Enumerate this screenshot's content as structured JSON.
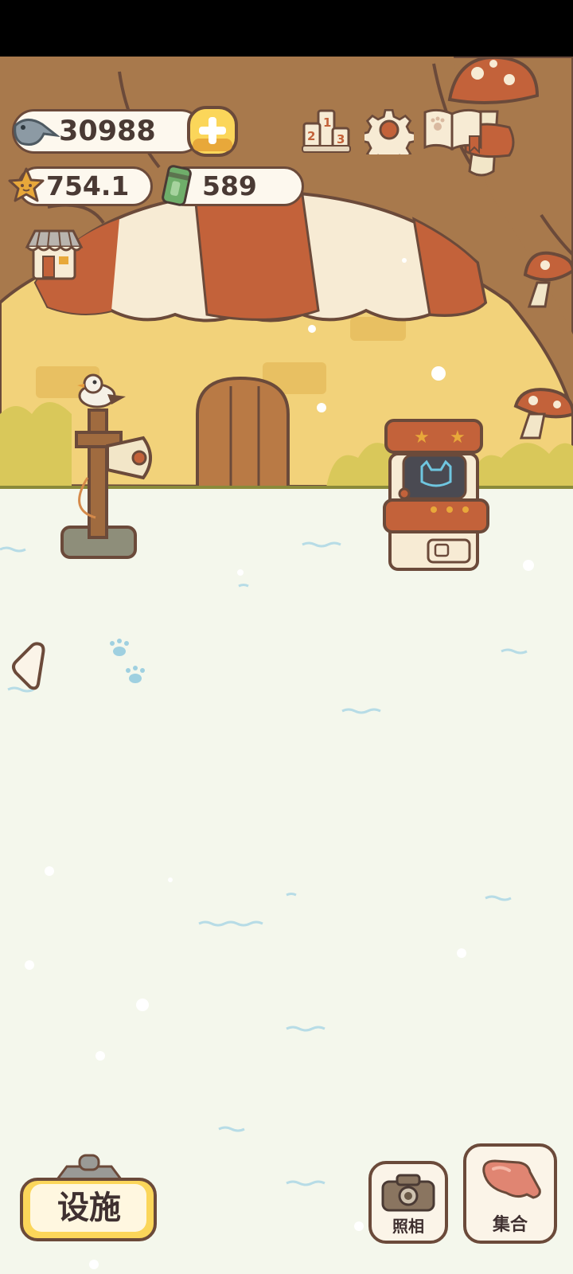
{
  "currency": {
    "fish": "30988",
    "stars": "754.1",
    "cans": "589"
  },
  "buttons": {
    "facilities": "设施",
    "photo": "照相",
    "gather": "集合"
  },
  "colors": {
    "status_bar": "#000000",
    "ground": "#f4f7ec",
    "outline": "#6b4a3a",
    "awning_red": "#c3623a",
    "awning_cream": "#f7ebd4",
    "wall_yellow": "#f2d27a",
    "sky": "#a9d3dc",
    "tree_trunk": "#a8794c",
    "gold_button": "#fbd65a"
  },
  "icons": {
    "fish": "fish-icon",
    "plus": "plus-icon",
    "leaderboard": "podium-icon",
    "settings": "gear-icon",
    "catalog": "open-book-icon",
    "star": "star-icon",
    "can": "can-icon",
    "shop": "shop-icon",
    "back": "chevron-left-icon",
    "camera": "camera-icon",
    "whistle": "whistle-icon"
  }
}
